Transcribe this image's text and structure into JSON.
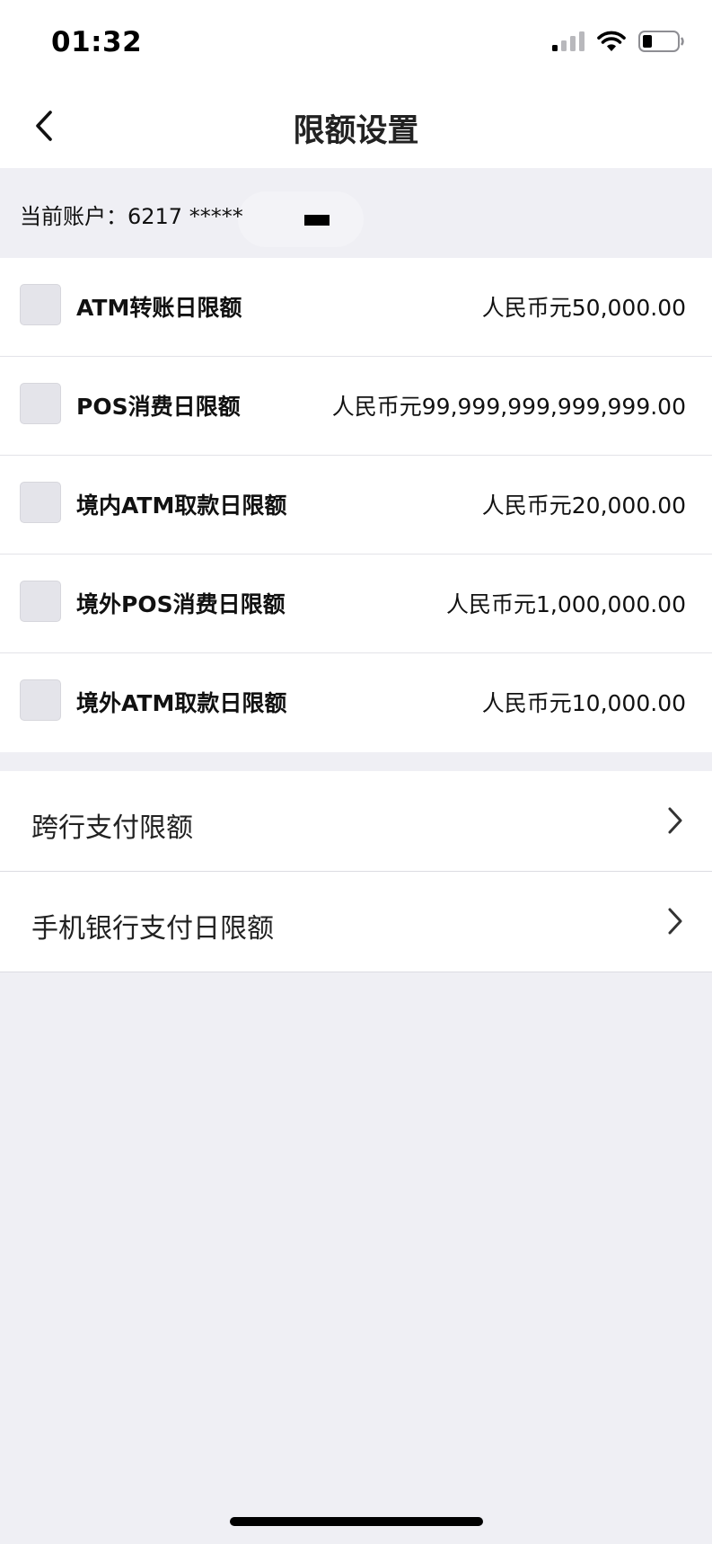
{
  "status_bar": {
    "time": "01:32",
    "icons": [
      "cellular-signal-icon",
      "wifi-icon",
      "battery-icon"
    ]
  },
  "header": {
    "title": "限额设置",
    "back_icon": "chevron-left-icon"
  },
  "account": {
    "text": "当前账户：6217 *****"
  },
  "limits": [
    {
      "label": "ATM转账日限额",
      "value": "人民币元50,000.00",
      "checked": false
    },
    {
      "label": "POS消费日限额",
      "value": "人民币元99,999,999,999,999.00",
      "checked": false
    },
    {
      "label": "境内ATM取款日限额",
      "value": "人民币元20,000.00",
      "checked": false
    },
    {
      "label": "境外POS消费日限额",
      "value": "人民币元1,000,000.00",
      "checked": false
    },
    {
      "label": "境外ATM取款日限额",
      "value": "人民币元10,000.00",
      "checked": false
    }
  ],
  "nav_items": [
    {
      "label": "跨行支付限额",
      "icon": "chevron-right-icon"
    },
    {
      "label": "手机银行支付日限额",
      "icon": "chevron-right-icon"
    }
  ],
  "colors": {
    "page_background": "#efeff4",
    "card_background": "#ffffff",
    "checkbox_fill": "#e4e4ea",
    "text_primary": "#111111"
  }
}
